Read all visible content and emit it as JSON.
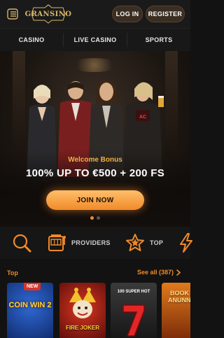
{
  "header": {
    "logo_text": "GRANSINO",
    "login_label": "LOG IN",
    "register_label": "REGISTER"
  },
  "nav": {
    "tabs": [
      {
        "label": "CASINO"
      },
      {
        "label": "LIVE CASINO"
      },
      {
        "label": "SPORTS"
      }
    ]
  },
  "hero": {
    "bonus_label": "Welcome Bonus",
    "bonus_title": "100% UP TO €500 + 200 FS",
    "cta_label": "JOIN NOW",
    "slides": 2,
    "active_slide": 1
  },
  "categories": [
    {
      "icon": "search-icon",
      "label": ""
    },
    {
      "icon": "slot-machine-icon",
      "label": "PROVIDERS"
    },
    {
      "icon": "star-icon",
      "label": "TOP"
    },
    {
      "icon": "lightning-icon",
      "label": ""
    }
  ],
  "section": {
    "title": "Top",
    "see_all": "See all (387)"
  },
  "games": [
    {
      "name": "COIN WIN 2",
      "badge": "NEW",
      "bg": "#1a3c8c"
    },
    {
      "name": "FIRE JOKER",
      "badge": "",
      "bg": "#8c1a1a"
    },
    {
      "name": "100 SUPER HOT",
      "badge": "",
      "bg": "#2a2a2a"
    },
    {
      "name": "BOOK OF ANUNNAKI",
      "badge": "",
      "bg": "#c85a10"
    }
  ],
  "colors": {
    "accent": "#f08a2a",
    "bonus_text": "#f2b13c",
    "background": "#121212"
  }
}
